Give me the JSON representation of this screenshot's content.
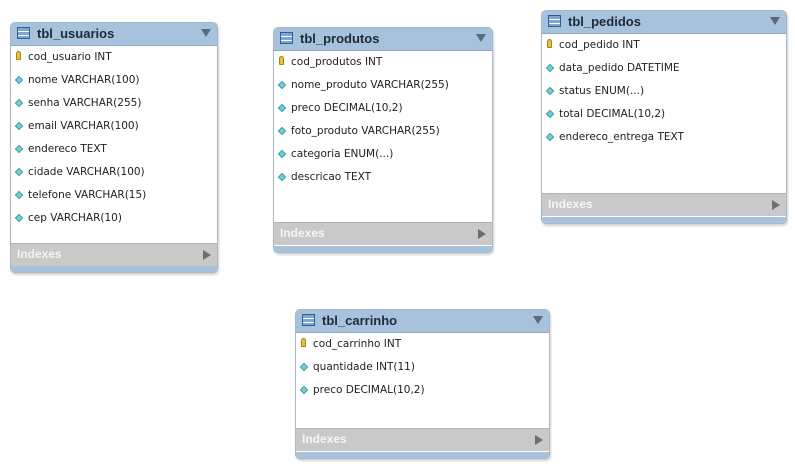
{
  "tables": [
    {
      "name": "tbl_usuarios",
      "indexes_label": "Indexes",
      "columns": [
        {
          "label": "cod_usuario INT",
          "key": "primary"
        },
        {
          "label": "nome VARCHAR(100)",
          "key": "none"
        },
        {
          "label": "senha VARCHAR(255)",
          "key": "none"
        },
        {
          "label": "email VARCHAR(100)",
          "key": "none"
        },
        {
          "label": "endereco TEXT",
          "key": "none"
        },
        {
          "label": "cidade VARCHAR(100)",
          "key": "none"
        },
        {
          "label": "telefone VARCHAR(15)",
          "key": "none"
        },
        {
          "label": "cep VARCHAR(10)",
          "key": "none"
        }
      ]
    },
    {
      "name": "tbl_produtos",
      "indexes_label": "Indexes",
      "columns": [
        {
          "label": "cod_produtos INT",
          "key": "primary"
        },
        {
          "label": "nome_produto VARCHAR(255)",
          "key": "none"
        },
        {
          "label": "preco DECIMAL(10,2)",
          "key": "none"
        },
        {
          "label": "foto_produto VARCHAR(255)",
          "key": "none"
        },
        {
          "label": "categoria ENUM(...)",
          "key": "none"
        },
        {
          "label": "descricao TEXT",
          "key": "none"
        }
      ]
    },
    {
      "name": "tbl_pedidos",
      "indexes_label": "Indexes",
      "columns": [
        {
          "label": "cod_pedido INT",
          "key": "primary"
        },
        {
          "label": "data_pedido DATETIME",
          "key": "none"
        },
        {
          "label": "status ENUM(...)",
          "key": "none"
        },
        {
          "label": "total DECIMAL(10,2)",
          "key": "none"
        },
        {
          "label": "endereco_entrega TEXT",
          "key": "none"
        }
      ]
    },
    {
      "name": "tbl_carrinho",
      "indexes_label": "Indexes",
      "columns": [
        {
          "label": "cod_carrinho INT",
          "key": "primary"
        },
        {
          "label": "quantidade INT(11)",
          "key": "none"
        },
        {
          "label": "preco DECIMAL(10,2)",
          "key": "none"
        }
      ]
    }
  ],
  "colors": {
    "header": "#a6c2dc",
    "indexes_bar": "#c9c9c9",
    "primary_key_icon": "#e8c23a",
    "column_icon": "#6fd0d8"
  },
  "icons": {
    "table": "table-icon",
    "primary_key": "key-icon",
    "column": "column-diamond-icon",
    "collapse": "chevron-down-icon",
    "expand_indexes": "chevron-right-icon"
  }
}
